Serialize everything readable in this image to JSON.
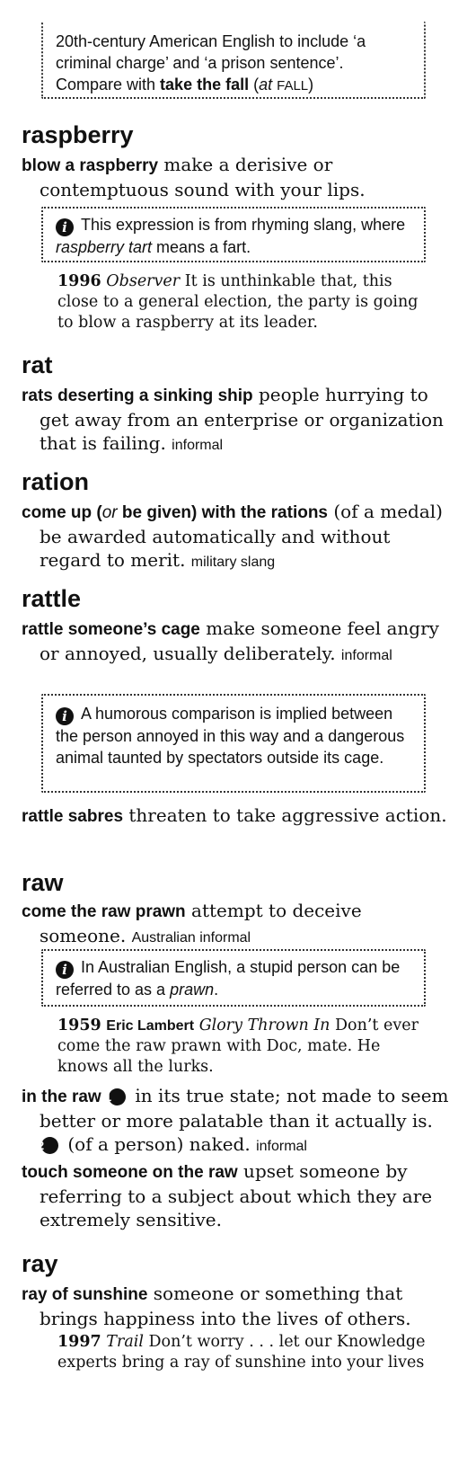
{
  "intro_note": {
    "line1": "20th-century American English to include ‘a",
    "line2": "criminal charge’ and ‘a prison sentence’.",
    "line3_pre": "Compare with ",
    "line3_bold": "take the fall",
    "line3_paren_open": " (",
    "line3_at": "at",
    "line3_ref": "FALL",
    "line3_paren_close": ")"
  },
  "entries": {
    "raspberry": {
      "headword": "raspberry",
      "phrase": "blow a raspberry",
      "definition": " make a derisive or contemptuous sound with your lips.",
      "note_pre": "This expression is from rhyming slang, where ",
      "note_italic": "raspberry tart",
      "note_post": " means a fart.",
      "cite_year": "1996",
      "cite_source": "Observer",
      "cite_text": " It is unthinkable that, this close to a general election, the party is going to blow a raspberry at its leader."
    },
    "rat": {
      "headword": "rat",
      "phrase": "rats deserting a sinking ship",
      "definition": " people hurrying to get away from an enterprise or organization that is failing.",
      "label": "informal"
    },
    "ration": {
      "headword": "ration",
      "phrase_a": "come up (",
      "phrase_or": "or",
      "phrase_b": " be given) with the rations",
      "definition": " (of a medal) be awarded automatically and without regard to merit.",
      "label": "military slang"
    },
    "rattle": {
      "headword": "rattle",
      "phrase1": "rattle someone’s cage",
      "definition1": " make someone feel angry or annoyed, usually deliberately.",
      "label1": "informal",
      "note": "A humorous comparison is implied between the person annoyed in this way and a dangerous animal taunted by spectators outside its cage.",
      "phrase2": "rattle sabres",
      "definition2": " threaten to take aggressive action."
    },
    "raw": {
      "headword": "raw",
      "phrase1": "come the raw prawn",
      "definition1": " attempt to deceive someone.",
      "label1": "Australian informal",
      "note_pre": "In Australian English, a stupid person can be referred to as a ",
      "note_italic": "prawn",
      "note_post": ".",
      "cite_year": "1959",
      "cite_author": "Eric Lambert",
      "cite_source": "Glory Thrown In",
      "cite_text": " Don’t ever come the raw prawn with Doc, mate. He knows all the lurks.",
      "phrase2": "in the raw",
      "sense1_num": "1",
      "sense1": " in its true state; not made to seem better or more palatable than it actually is. ",
      "sense2_num": "2",
      "sense2": " (of a person) naked.",
      "label2": "informal",
      "phrase3": "touch someone on the raw",
      "definition3": " upset someone by referring to a subject about which they are extremely sensitive."
    },
    "ray": {
      "headword": "ray",
      "phrase": "ray of sunshine",
      "definition": " someone or something that brings happiness into the lives of others.",
      "cite_year": "1997",
      "cite_source": "Trail",
      "cite_text": " Don’t worry . . . let our Knowledge experts bring a ray of sunshine into your lives"
    }
  }
}
